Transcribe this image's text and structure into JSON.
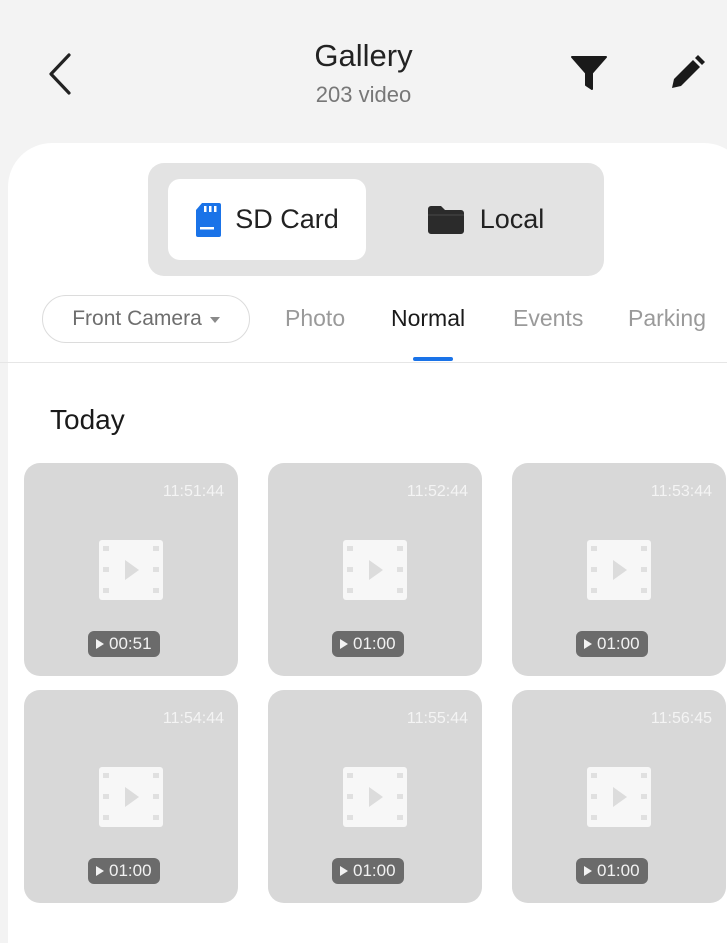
{
  "header": {
    "title": "Gallery",
    "subtitle": "203 video",
    "back_icon": "chevron-left-icon",
    "filter_icon": "filter-funnel-icon",
    "edit_icon": "pencil-icon"
  },
  "storage": {
    "options": [
      {
        "label": "SD Card",
        "icon": "sd-card-icon",
        "selected": true
      },
      {
        "label": "Local",
        "icon": "folder-icon",
        "selected": false
      }
    ]
  },
  "filters": {
    "camera_select": "Front Camera",
    "tabs": [
      {
        "label": "Photo",
        "active": false
      },
      {
        "label": "Normal",
        "active": true
      },
      {
        "label": "Events",
        "active": false
      },
      {
        "label": "Parking",
        "active": false
      }
    ]
  },
  "section": {
    "title": "Today"
  },
  "videos": [
    {
      "time": "11:51:44",
      "duration": "00:51"
    },
    {
      "time": "11:52:44",
      "duration": "01:00"
    },
    {
      "time": "11:53:44",
      "duration": "01:00"
    },
    {
      "time": "11:54:44",
      "duration": "01:00"
    },
    {
      "time": "11:55:44",
      "duration": "01:00"
    },
    {
      "time": "11:56:45",
      "duration": "01:00"
    }
  ],
  "colors": {
    "accent": "#1a73e8",
    "sd_card_icon": "#1a73e8",
    "thumbnail_bg": "#d8d8d8"
  }
}
